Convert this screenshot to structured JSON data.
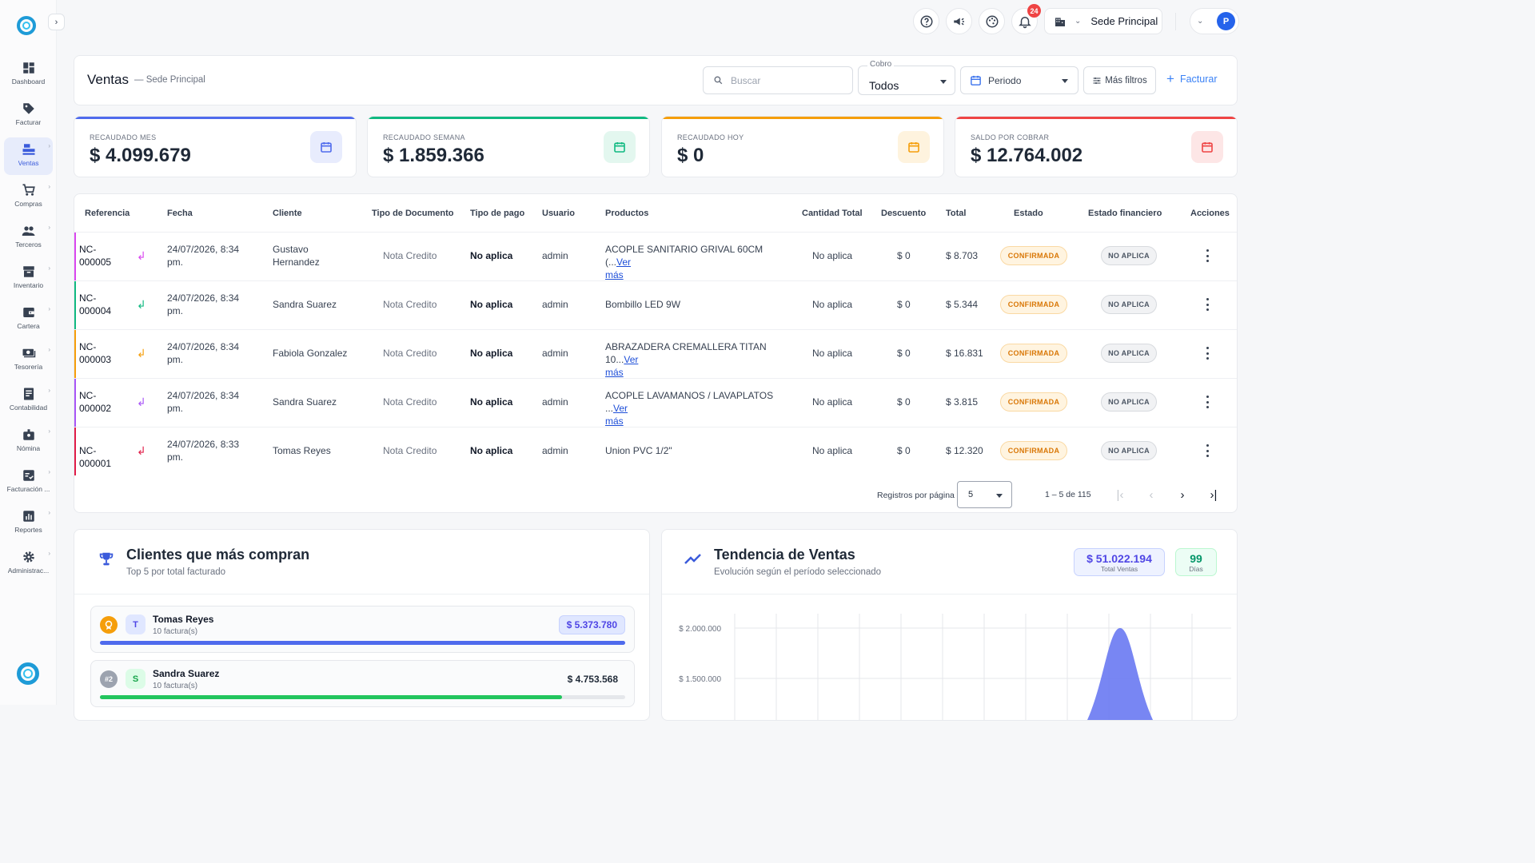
{
  "sidebar": {
    "items": [
      {
        "label": "Dashboard",
        "icon": "dashboard-icon",
        "has_submenu": false
      },
      {
        "label": "Facturar",
        "icon": "tag-icon",
        "has_submenu": false
      },
      {
        "label": "Ventas",
        "icon": "cash-register-icon",
        "has_submenu": true,
        "active": true
      },
      {
        "label": "Compras",
        "icon": "cart-icon",
        "has_submenu": true
      },
      {
        "label": "Terceros",
        "icon": "people-icon",
        "has_submenu": true
      },
      {
        "label": "Inventario",
        "icon": "inventory-icon",
        "has_submenu": true
      },
      {
        "label": "Cartera",
        "icon": "wallet-icon",
        "has_submenu": true
      },
      {
        "label": "Tesorería",
        "icon": "cash-icon",
        "has_submenu": true
      },
      {
        "label": "Contabilidad",
        "icon": "ledger-icon",
        "has_submenu": true
      },
      {
        "label": "Nómina",
        "icon": "badge-icon",
        "has_submenu": true
      },
      {
        "label": "Facturación ...",
        "icon": "invoice-check-icon",
        "has_submenu": true
      },
      {
        "label": "Reportes",
        "icon": "bar-chart-icon",
        "has_submenu": true
      },
      {
        "label": "Administrac...",
        "icon": "gear-icon",
        "has_submenu": true
      }
    ]
  },
  "topbar": {
    "notifications_count": "24",
    "sede_label": "Sede Principal",
    "user_initial": "P"
  },
  "header": {
    "title": "Ventas",
    "subtitle": "— Sede Principal",
    "search_placeholder": "Buscar",
    "cobro_label": "Cobro",
    "cobro_value": "Todos",
    "periodo_label": "Periodo",
    "mas_filtros_label": "Más filtros",
    "facturar_label": "Facturar"
  },
  "kpis": [
    {
      "label": "RECAUDADO MES",
      "value": "$ 4.099.679",
      "color": "#4f6bed",
      "icon": "calendar-month-icon"
    },
    {
      "label": "RECAUDADO SEMANA",
      "value": "$ 1.859.366",
      "color": "#10b981",
      "icon": "calendar-week-icon"
    },
    {
      "label": "RECAUDADO HOY",
      "value": "$ 0",
      "color": "#f59e0b",
      "icon": "calendar-today-icon"
    },
    {
      "label": "SALDO POR COBRAR",
      "value": "$ 12.764.002",
      "color": "#ef4444",
      "icon": "wallet-icon"
    }
  ],
  "table": {
    "headers": [
      "Referencia",
      "Fecha",
      "Cliente",
      "Tipo de Documento",
      "Tipo de pago",
      "Usuario",
      "Productos",
      "Cantidad Total",
      "Descuento",
      "Total",
      "Estado",
      "Estado financiero",
      "Acciones"
    ],
    "rows": [
      {
        "ref1": "NC-",
        "ref2": "000005",
        "fecha1": "24/07/2026, 8:34",
        "fecha2": "pm.",
        "cliente1": "Gustavo",
        "cliente2": "Hernandez",
        "tipo_doc": "Nota Credito",
        "tipo_pago": "No aplica",
        "usuario": "admin",
        "prod1": "ACOPLE SANITARIO GRIVAL 60CM (...",
        "prod_link1": "Ver",
        "prod_link2": "más",
        "cantidad": "No aplica",
        "descuento": "$ 0",
        "total": "$ 8.703",
        "estado": "CONFIRMADA",
        "estado_fin": "NO APLICA",
        "stripe": "#d946ef"
      },
      {
        "ref1": "NC-",
        "ref2": "000004",
        "fecha1": "24/07/2026, 8:34",
        "fecha2": "pm.",
        "cliente1": "Sandra Suarez",
        "cliente2": "",
        "tipo_doc": "Nota Credito",
        "tipo_pago": "No aplica",
        "usuario": "admin",
        "prod1": "Bombillo LED 9W",
        "prod_link1": "",
        "prod_link2": "",
        "cantidad": "No aplica",
        "descuento": "$ 0",
        "total": "$ 5.344",
        "estado": "CONFIRMADA",
        "estado_fin": "NO APLICA",
        "stripe": "#10b981"
      },
      {
        "ref1": "NC-",
        "ref2": "000003",
        "fecha1": "24/07/2026, 8:34",
        "fecha2": "pm.",
        "cliente1": "Fabiola Gonzalez",
        "cliente2": "",
        "tipo_doc": "Nota Credito",
        "tipo_pago": "No aplica",
        "usuario": "admin",
        "prod1": "ABRAZADERA CREMALLERA TITAN 10...",
        "prod_link1": "Ver",
        "prod_link2": "más",
        "cantidad": "No aplica",
        "descuento": "$ 0",
        "total": "$ 16.831",
        "estado": "CONFIRMADA",
        "estado_fin": "NO APLICA",
        "stripe": "#f59e0b"
      },
      {
        "ref1": "NC-",
        "ref2": "000002",
        "fecha1": "24/07/2026, 8:34",
        "fecha2": "pm.",
        "cliente1": "Sandra Suarez",
        "cliente2": "",
        "tipo_doc": "Nota Credito",
        "tipo_pago": "No aplica",
        "usuario": "admin",
        "prod1": "ACOPLE LAVAMANOS / LAVAPLATOS ...",
        "prod_link1": "Ver",
        "prod_link2": "más",
        "cantidad": "No aplica",
        "descuento": "$ 0",
        "total": "$ 3.815",
        "estado": "CONFIRMADA",
        "estado_fin": "NO APLICA",
        "stripe": "#a855f7"
      },
      {
        "ref1": "NC-000001",
        "ref2": "",
        "fecha1": "24/07/2026, 8:33",
        "fecha2": "pm.",
        "cliente1": "Tomas Reyes",
        "cliente2": "",
        "tipo_doc": "Nota Credito",
        "tipo_pago": "No aplica",
        "usuario": "admin",
        "prod1": "Union PVC 1/2\"",
        "prod_link1": "",
        "prod_link2": "",
        "cantidad": "No aplica",
        "descuento": "$ 0",
        "total": "$ 12.320",
        "estado": "CONFIRMADA",
        "estado_fin": "NO APLICA",
        "stripe": "#e11d48"
      }
    ],
    "pagination": {
      "per_page_label": "Registros por página",
      "per_page_value": "5",
      "range": "1 – 5 de 115"
    }
  },
  "clients": {
    "title": "Clientes que más compran",
    "subtitle": "Top 5 por total facturado",
    "items": [
      {
        "rank": "1",
        "initial": "T",
        "name": "Tomas Reyes",
        "sub": "10 factura(s)",
        "amount": "$ 5.373.780",
        "share": 1.0,
        "color": "#4f6bed"
      },
      {
        "rank": "#2",
        "initial": "S",
        "name": "Sandra Suarez",
        "sub": "10 factura(s)",
        "amount": "$ 4.753.568",
        "share": 0.88,
        "color": "#22c55e"
      }
    ]
  },
  "trend": {
    "title": "Tendencia de Ventas",
    "subtitle": "Evolución según el período seleccionado",
    "total_value": "$ 51.022.194",
    "total_label": "Total Ventas",
    "dias_value": "99",
    "dias_label": "Días"
  },
  "chart_data": {
    "type": "area",
    "y_ticks": [
      "$ 2.000.000",
      "$ 1.500.000"
    ],
    "series": [
      {
        "values": [
          0,
          0,
          0,
          0,
          0,
          0,
          0,
          0,
          0,
          0,
          0,
          2000000,
          0,
          0,
          0,
          0,
          0,
          0,
          0,
          0
        ]
      }
    ],
    "color": "#6d7cf2",
    "grid": true
  }
}
